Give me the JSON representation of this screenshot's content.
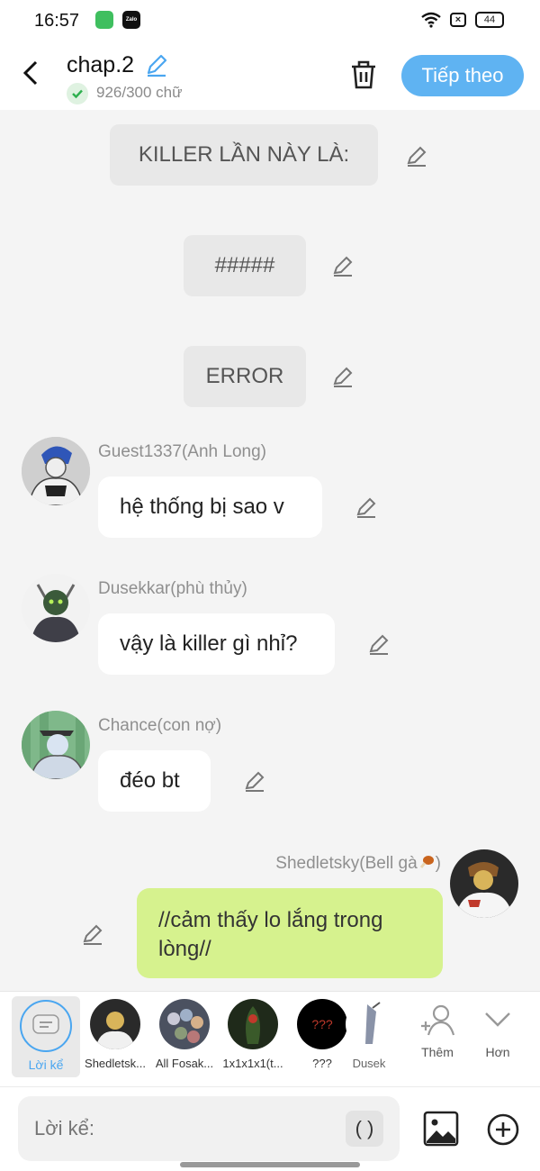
{
  "status": {
    "time": "16:57",
    "app1": "",
    "app2": "Zalo",
    "battery": "44"
  },
  "header": {
    "title": "chap.2",
    "word_count": "926/300 chữ",
    "next_label": "Tiếp theo"
  },
  "narrations": [
    {
      "text": "KILLER LẦN NÀY LÀ:"
    },
    {
      "text": "#####"
    },
    {
      "text": "ERROR"
    }
  ],
  "messages": [
    {
      "name": "Guest1337(Anh Long)",
      "text": "hệ thống bị sao v"
    },
    {
      "name": "Dusekkar(phù thủy)",
      "text": "vậy là killer gì nhỉ?"
    },
    {
      "name": "Chance(con nợ)",
      "text": "đéo bt"
    },
    {
      "name": "Shedletsky(Bell gà",
      "text": "//cảm thấy lo lắng trong lòng//"
    }
  ],
  "characters": [
    {
      "label": "Lời kể"
    },
    {
      "label": "Shedletsk..."
    },
    {
      "label": "All Fosak..."
    },
    {
      "label": "1x1x1x1(t..."
    },
    {
      "label": "???"
    },
    {
      "label": "Dusek"
    }
  ],
  "tools": {
    "add_label": "Thêm",
    "more_label": "Hơn"
  },
  "input": {
    "placeholder": "Lời kể:",
    "paren": "( )"
  },
  "colors": {
    "accent": "#5fb3f2",
    "my_bubble": "#d6f28e",
    "narration_bg": "#e8e8e8"
  }
}
